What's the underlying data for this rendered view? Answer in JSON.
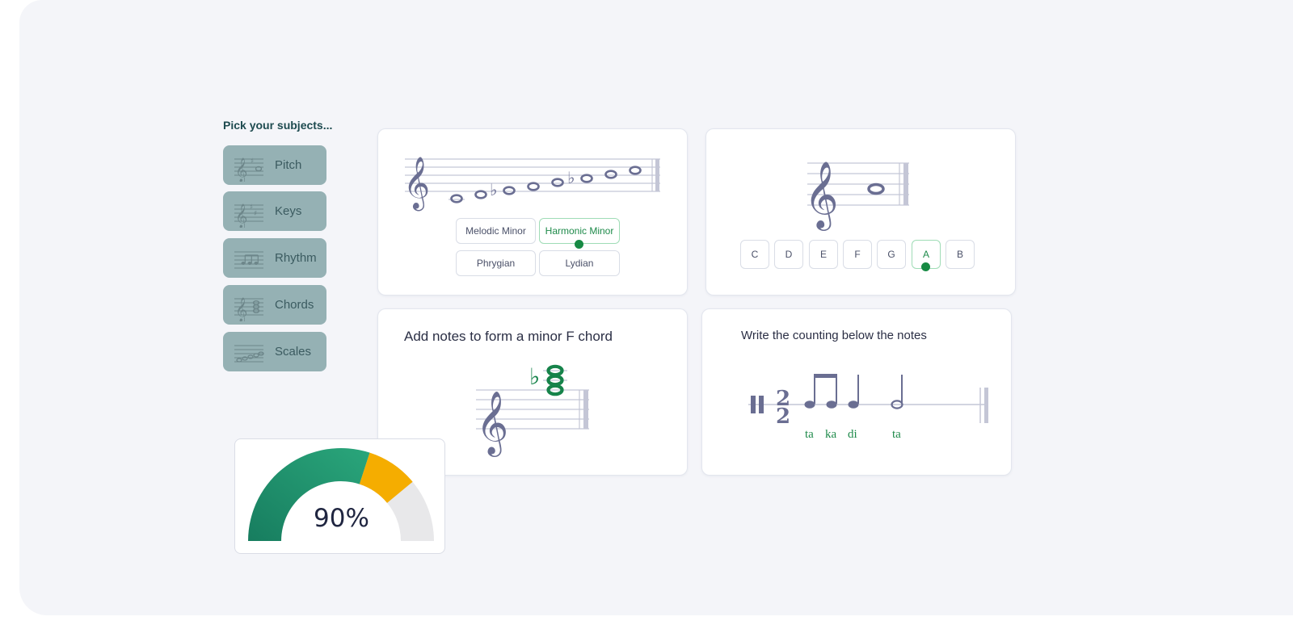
{
  "subjects": {
    "title": "Pick your subjects...",
    "items": [
      {
        "label": "Pitch",
        "icon": "treble-clef-note-icon"
      },
      {
        "label": "Keys",
        "icon": "key-signature-icon"
      },
      {
        "label": "Rhythm",
        "icon": "rhythm-notes-icon"
      },
      {
        "label": "Chords",
        "icon": "chord-stack-icon"
      },
      {
        "label": "Scales",
        "icon": "scale-notes-icon"
      }
    ]
  },
  "scale_card": {
    "options": [
      "Melodic Minor",
      "Harmonic Minor",
      "Phrygian",
      "Lydian"
    ],
    "selected": "Harmonic Minor"
  },
  "note_card": {
    "options": [
      "C",
      "D",
      "E",
      "F",
      "G",
      "A",
      "B"
    ],
    "selected": "A"
  },
  "chord_card": {
    "title": "Add notes to form a minor F chord"
  },
  "rhythm_card": {
    "title": "Write the counting below the notes",
    "syllables": [
      "ta",
      "ka",
      "di",
      "ta"
    ]
  },
  "score": {
    "value_label": "90%",
    "fraction": 0.9,
    "colors": {
      "green": "#1f9a74",
      "orange": "#f5ad00",
      "track": "#e8e8ea"
    }
  },
  "colors": {
    "accent": "#1e8a4a",
    "notation": "#6a6e92",
    "subject_bg": "#95b1b4"
  }
}
